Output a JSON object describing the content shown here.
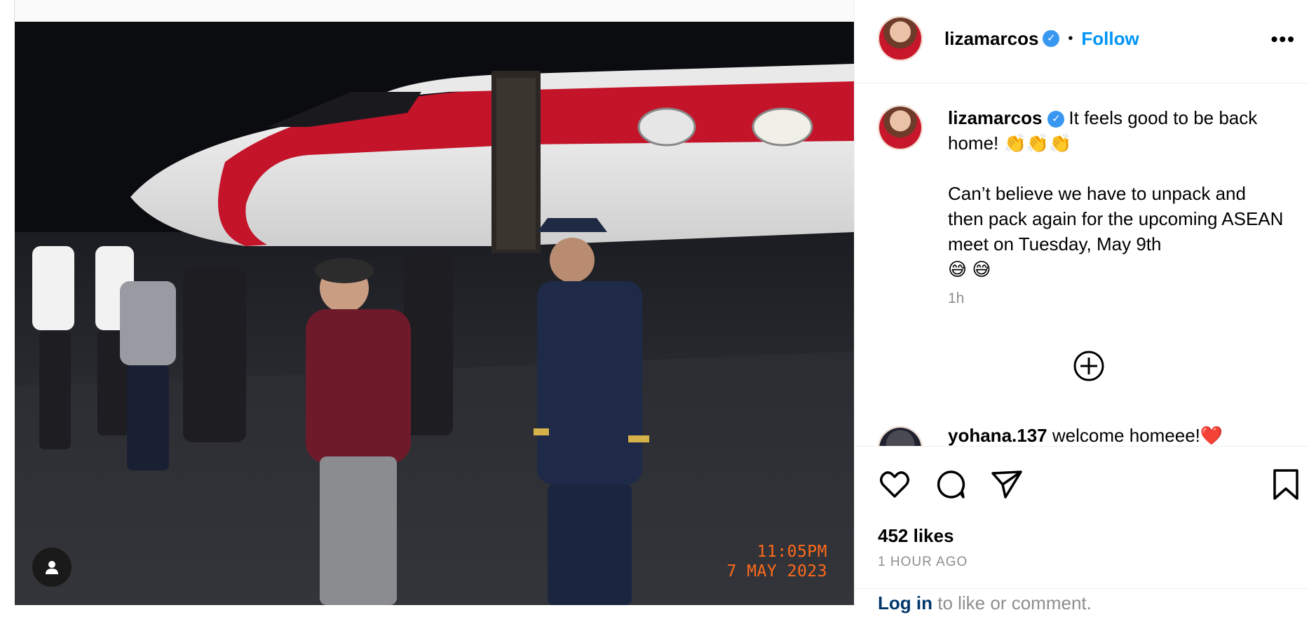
{
  "post": {
    "image_alt": "Arrival at airport at night beside red and white jet",
    "timestamp_stamp": {
      "time": "11:05PM",
      "date": "7 MAY 2023"
    }
  },
  "header": {
    "username": "lizamarcos",
    "separator": "•",
    "follow_label": "Follow",
    "more_icon": "more-icon"
  },
  "caption": {
    "username": "lizamarcos",
    "line1": "It feels good to be back home! 👏👏👏",
    "line2": "Can’t believe we have to unpack and then pack again for the upcoming ASEAN meet on Tuesday, May 9th",
    "emoji": "😅 😅",
    "time": "1h"
  },
  "comments": [
    {
      "username": "yohana.137",
      "text": "welcome homeee!❤️"
    }
  ],
  "actions": {
    "likes": "452 likes",
    "posted": "1 HOUR AGO",
    "login_link": "Log in",
    "login_rest": "to like or comment."
  },
  "colors": {
    "accent": "#0095f6",
    "verified": "#3897f0",
    "stamp": "#ff6a1a"
  }
}
